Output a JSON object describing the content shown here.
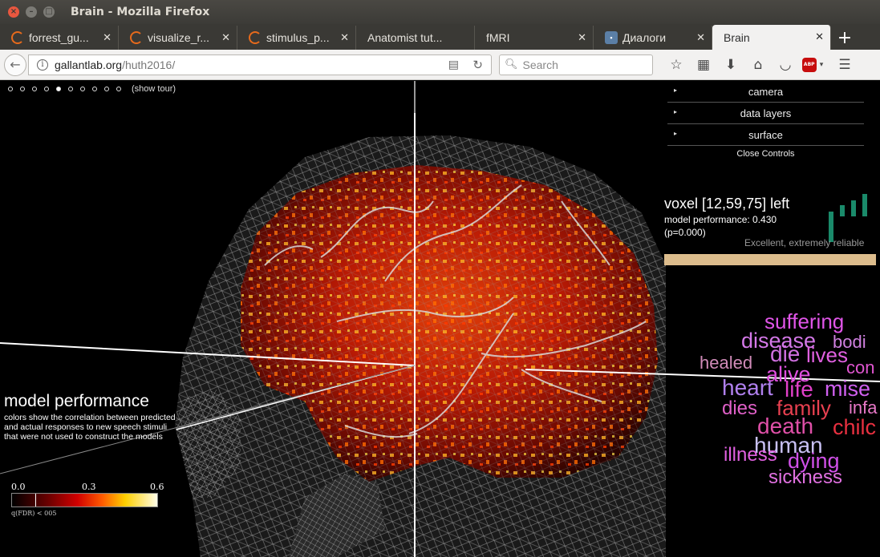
{
  "window": {
    "title": "Brain - Mozilla Firefox"
  },
  "tabs": [
    {
      "label": "forrest_gu...",
      "icon": "loading-icon"
    },
    {
      "label": "visualize_r...",
      "icon": "loading-icon"
    },
    {
      "label": "stimulus_p...",
      "icon": "loading-icon"
    },
    {
      "label": "Anatomist tut...",
      "icon": "none"
    },
    {
      "label": "fMRI",
      "icon": "none"
    },
    {
      "label": "Диалоги",
      "icon": "vk-icon"
    },
    {
      "label": "Brain",
      "icon": "none",
      "active": true
    }
  ],
  "nav": {
    "url_domain": "gallantlab.org",
    "url_path": "/huth2016/",
    "search_placeholder": "Search",
    "adblock_label": "ABP"
  },
  "tour": {
    "dots": 10,
    "active_index": 4,
    "link": "(show tour)"
  },
  "controls": {
    "sections": [
      "camera",
      "data layers",
      "surface"
    ],
    "close_label": "Close Controls"
  },
  "voxel": {
    "title": "voxel [12,59,75] left",
    "performance": "model performance: 0.430",
    "p_value": "(p=0.000)",
    "quality": "Excellent, extremely reliable",
    "bar_color": "#dcbc8c"
  },
  "wordcloud": [
    {
      "text": "suffering",
      "color": "#e055e8",
      "size": 26
    },
    {
      "text": "disease",
      "color": "#d478e8",
      "size": 27
    },
    {
      "text": "bodi",
      "color": "#d080e0",
      "size": 22
    },
    {
      "text": "healed",
      "color": "#d08bb8",
      "size": 22
    },
    {
      "text": "die",
      "color": "#d070e0",
      "size": 28
    },
    {
      "text": "lives",
      "color": "#e060e0",
      "size": 26
    },
    {
      "text": "alive",
      "color": "#e050e0",
      "size": 27
    },
    {
      "text": "con",
      "color": "#e055d0",
      "size": 22
    },
    {
      "text": "heart",
      "color": "#b080ee",
      "size": 28
    },
    {
      "text": "life",
      "color": "#e040c8",
      "size": 28
    },
    {
      "text": "mise",
      "color": "#d060f0",
      "size": 27
    },
    {
      "text": "dies",
      "color": "#e060c8",
      "size": 24
    },
    {
      "text": "family",
      "color": "#e84050",
      "size": 26
    },
    {
      "text": "infa",
      "color": "#e878c8",
      "size": 22
    },
    {
      "text": "death",
      "color": "#e050a8",
      "size": 28
    },
    {
      "text": "chilc",
      "color": "#e83040",
      "size": 27
    },
    {
      "text": "human",
      "color": "#c8c0f4",
      "size": 28
    },
    {
      "text": "illness",
      "color": "#e060e0",
      "size": 24
    },
    {
      "text": "dying",
      "color": "#d050e8",
      "size": 27
    },
    {
      "text": "sickness",
      "color": "#e070e0",
      "size": 24
    }
  ],
  "performance_legend": {
    "title": "model performance",
    "description": "colors show the correlation between predicted and actual responses to new speech stimuli that were not used to construct the models"
  },
  "colorbar": {
    "ticks": [
      "0.0",
      "0.3",
      "0.6"
    ],
    "min": 0.0,
    "max": 0.6,
    "threshold_label": "q(FDR) < 005"
  }
}
